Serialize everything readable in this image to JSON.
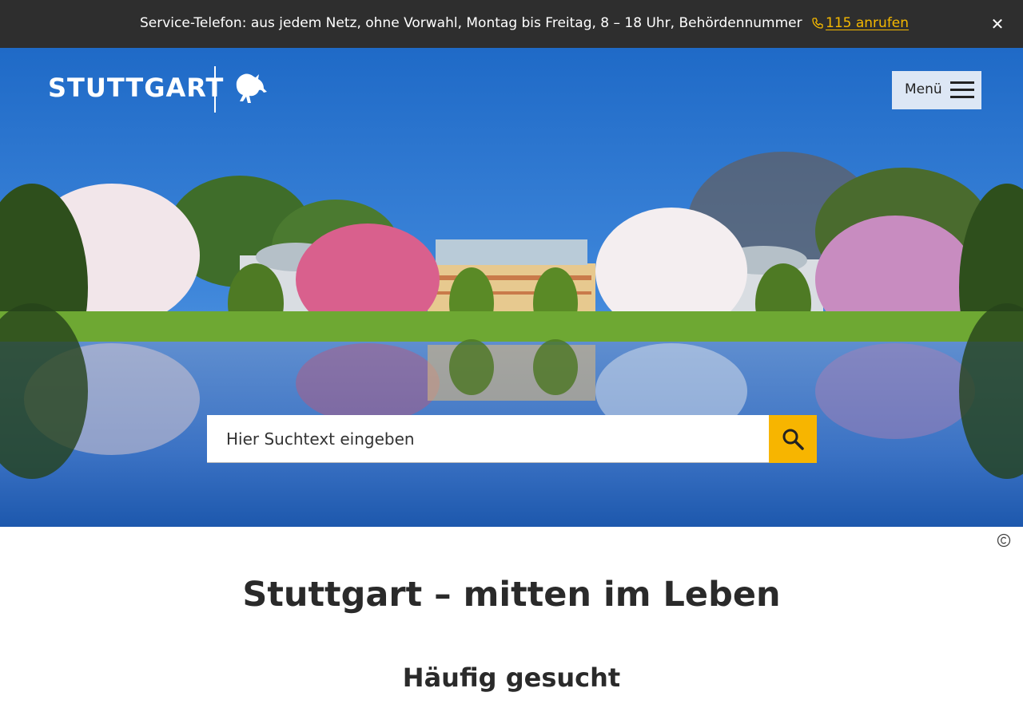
{
  "service_bar": {
    "text": "Service-Telefon: aus jedem Netz, ohne Vorwahl, Montag bis Freitag, 8 – 18 Uhr, Behördennummer",
    "call_link": "115 anrufen",
    "close_label": "✕",
    "icon": "phone-icon"
  },
  "header": {
    "logo_text": "STUTTGART",
    "logo_emblem": "horse-icon",
    "menu_label": "Menü"
  },
  "search": {
    "placeholder": "Hier Suchtext eingeben",
    "button_icon": "search-icon"
  },
  "hero": {
    "copyright_icon": "copyright-icon"
  },
  "main": {
    "title": "Stuttgart – mitten im Leben",
    "section_title": "Häufig gesucht"
  },
  "colors": {
    "accent": "#f7b500",
    "topbar": "#2e2e2e",
    "menu_bg": "#dde7f5"
  }
}
